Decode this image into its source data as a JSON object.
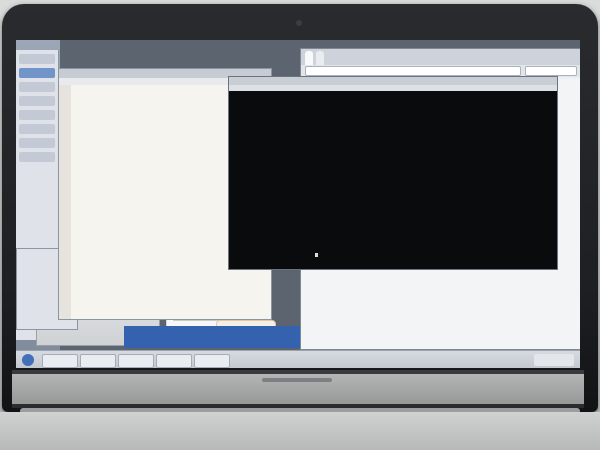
{
  "browser": {
    "tabs": [
      "",
      ""
    ],
    "url": "",
    "search_placeholder": ""
  },
  "editor": {
    "title": "",
    "menu": "",
    "code_lines": []
  },
  "terminal": {
    "title": "",
    "menu": "",
    "output_lines": []
  },
  "colors": {
    "bezel": "#1e1f22",
    "terminal_bg": "#0a0b0d",
    "blue_pane": "#2f63b7",
    "badge_accent": "#f0a23a",
    "wire": "#d6c24a"
  },
  "icons": [
    "webcam-icon",
    "start-menu-icon",
    "status-badge-icon"
  ]
}
